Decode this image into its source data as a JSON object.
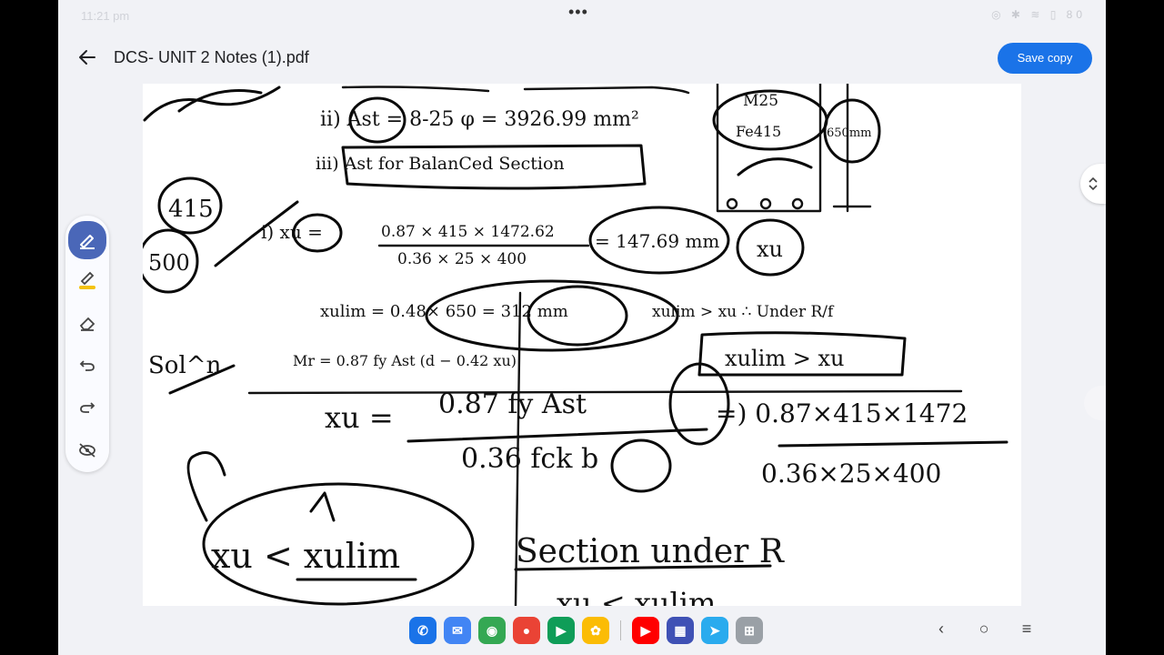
{
  "status_bar": {
    "time": "11:21 pm",
    "more": "•••",
    "indicators": "◎ ✱ ≋ ▯ 80"
  },
  "app_bar": {
    "title": "DCS- UNIT 2 Notes  (1).pdf",
    "save_label": "Save copy"
  },
  "notes": {
    "line1": "ii)  Ast = 8-25 φ = 3926.99 mm²",
    "line2": "iii)  Ast for  BalanCed Section",
    "line3_lhs": "i)  xu =",
    "line3_num": "0.87 × 415 × 1472.62",
    "line3_den": "0.36 × 25 × 400",
    "line3_res": "= 147.69 mm",
    "line4": "xulim = 0.48× 650 = 312 mm",
    "line4b": "xulim > xu  ∴ Under R/f",
    "line5": "Mr = 0.87 fy Ast (d − 0.42 xu)",
    "box_mark": "xulim > xu",
    "section_labels": [
      "M25",
      "Fe415",
      "650mm"
    ],
    "margin": [
      "415",
      "500",
      "Sol^n"
    ],
    "formula_lhs": "xu =",
    "formula_num": "0.87 fy Ast",
    "formula_den": "0.36 fck b",
    "formula_calc_num": "=) 0.87×415×1472",
    "formula_calc_den": "0.36×25×400",
    "compare": "xu < xulim",
    "verdict": "Section under R",
    "bottom": "xu < xulim"
  },
  "toolbar": {
    "tools": [
      "pen",
      "highlighter",
      "eraser",
      "undo",
      "redo",
      "hide-annotations"
    ]
  },
  "dock_apps": [
    {
      "name": "phone",
      "color": "#1a73e8",
      "glyph": "✆"
    },
    {
      "name": "messages",
      "color": "#4285f4",
      "glyph": "✉"
    },
    {
      "name": "chrome",
      "color": "#34a853",
      "glyph": "◉"
    },
    {
      "name": "assistant",
      "color": "#ea4335",
      "glyph": "●"
    },
    {
      "name": "play-store",
      "color": "#0f9d58",
      "glyph": "▶"
    },
    {
      "name": "photos",
      "color": "#fbbc05",
      "glyph": "✿"
    },
    {
      "name": "youtube",
      "color": "#ff0000",
      "glyph": "▶"
    },
    {
      "name": "gallery",
      "color": "#3f51b5",
      "glyph": "▦"
    },
    {
      "name": "telegram",
      "color": "#2aabee",
      "glyph": "➤"
    },
    {
      "name": "app-drawer",
      "color": "#9aa0a6",
      "glyph": "⊞"
    }
  ],
  "nav": {
    "back": "‹",
    "home": "○",
    "recents": "≡"
  }
}
